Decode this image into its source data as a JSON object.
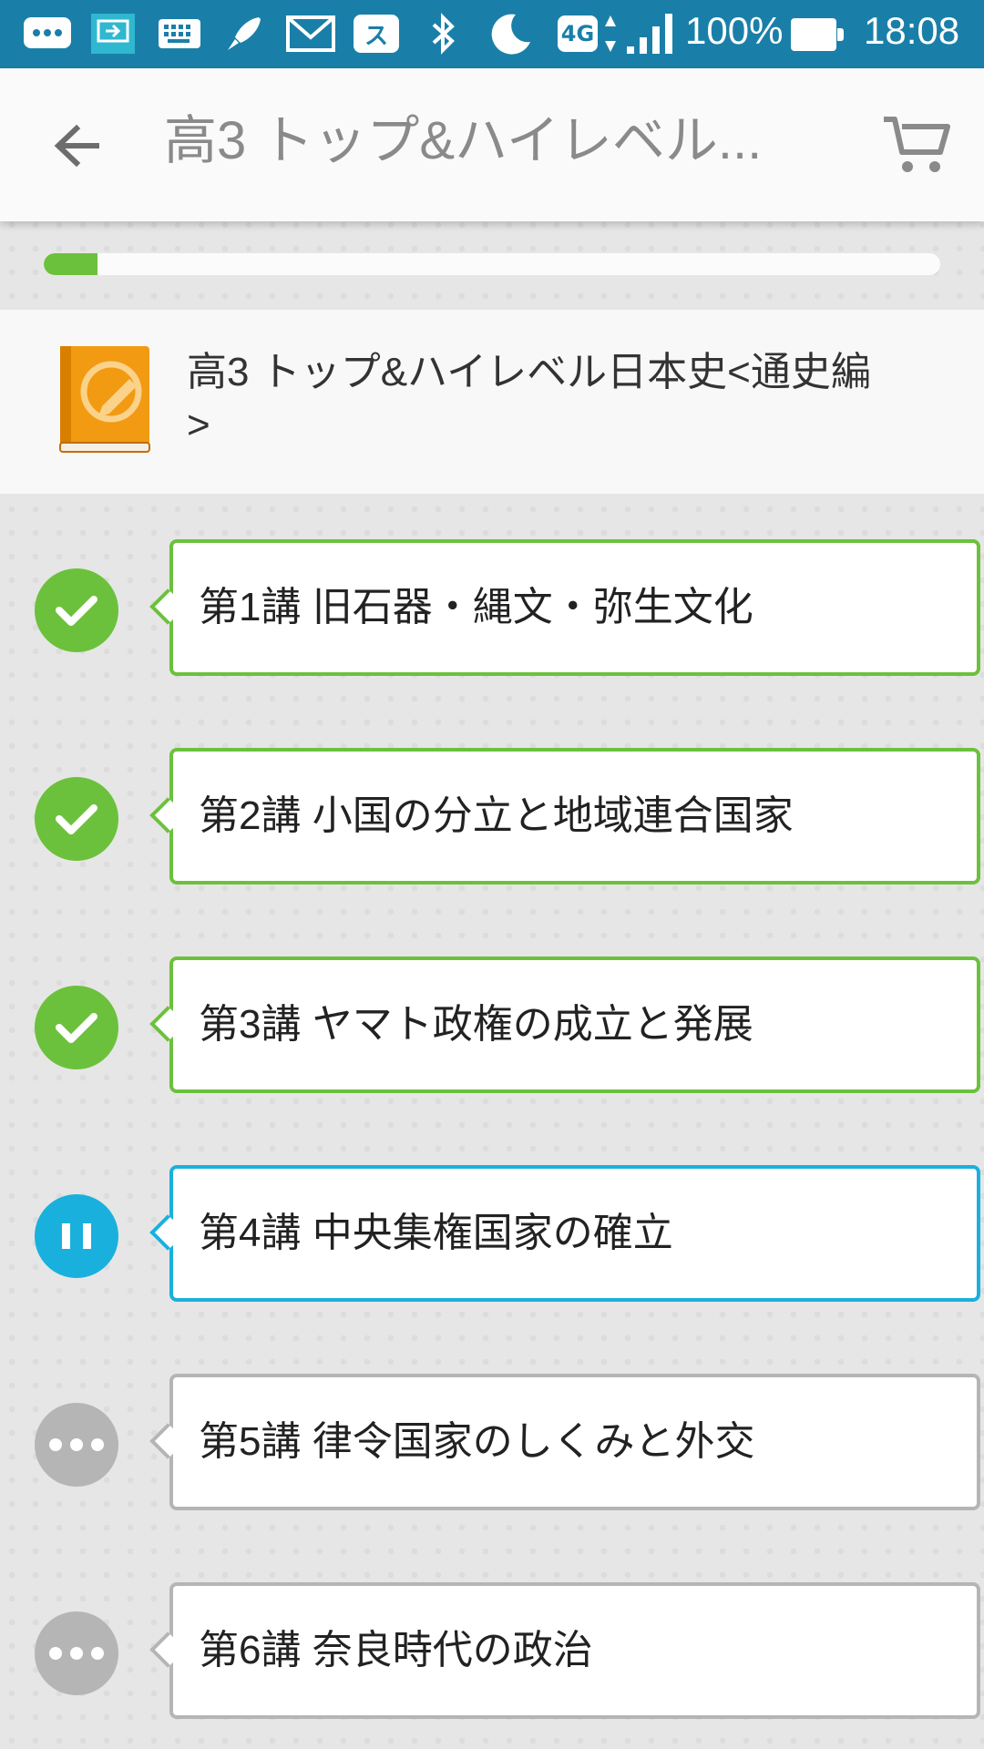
{
  "status_bar": {
    "icons": [
      "messages-icon",
      "screen-share-icon",
      "keyboard-icon",
      "rocket-icon",
      "gmail-icon",
      "app-su-icon",
      "bluetooth-icon",
      "moon-icon",
      "4g-icon",
      "signal-icon"
    ],
    "network_label": "4G",
    "battery_percent": "100%",
    "time": "18:08"
  },
  "app_bar": {
    "back_icon": "arrow-left-icon",
    "title": "高3 トップ&ハイレベル...",
    "cart_icon": "cart-icon"
  },
  "progress": {
    "fraction": 0.06,
    "color": "#6cc13c"
  },
  "book": {
    "icon": "book-icon",
    "title_line1": "高3 トップ&ハイレベル日本史<通史編",
    "title_line2": ">"
  },
  "colors": {
    "done": "#6cc13c",
    "current": "#1ab0de",
    "locked": "#b5b5b5",
    "book_orange": "#f29a12"
  },
  "lessons": [
    {
      "label": "第1講 旧石器・縄文・弥生文化",
      "status": "done"
    },
    {
      "label": "第2講 小国の分立と地域連合国家",
      "status": "done"
    },
    {
      "label": "第3講 ヤマト政権の成立と発展",
      "status": "done"
    },
    {
      "label": "第4講 中央集権国家の確立",
      "status": "current"
    },
    {
      "label": "第5講 律令国家のしくみと外交",
      "status": "locked"
    },
    {
      "label": "第6講 奈良時代の政治",
      "status": "locked"
    }
  ]
}
